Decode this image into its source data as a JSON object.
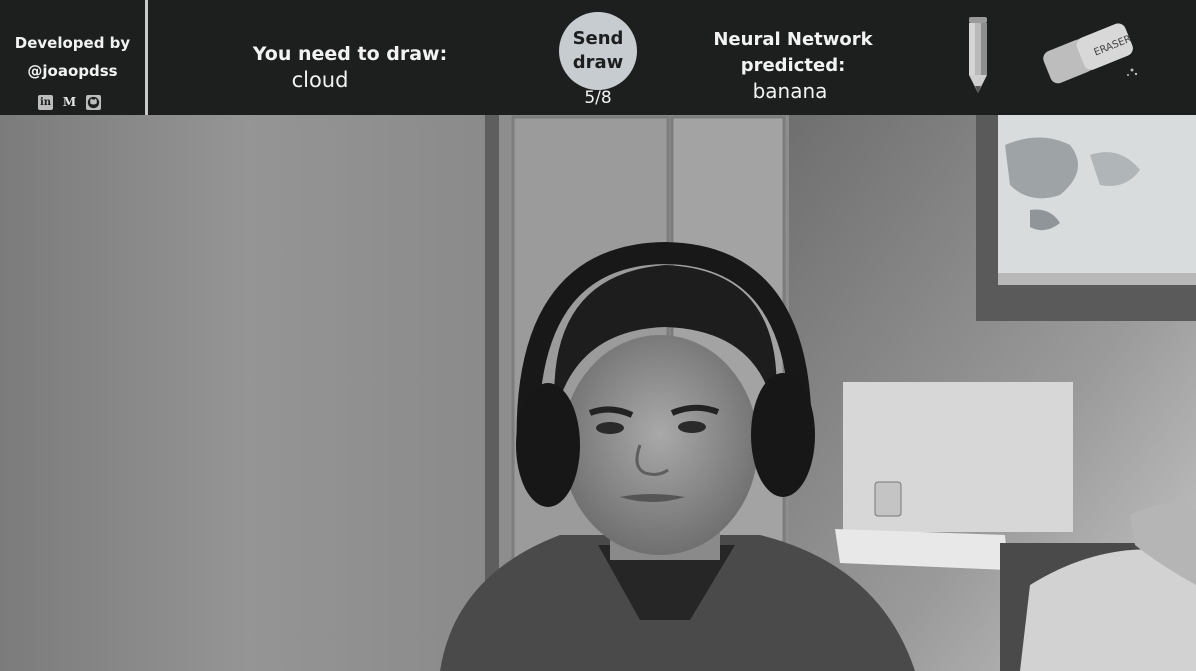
{
  "credits": {
    "line1": "Developed by",
    "line2": "@joaopdss"
  },
  "social": [
    {
      "icon": "linkedin-icon",
      "glyph": "in"
    },
    {
      "icon": "medium-icon",
      "glyph": "M"
    },
    {
      "icon": "github-icon",
      "glyph": ""
    }
  ],
  "task": {
    "label": "You need to draw:",
    "word": "cloud"
  },
  "send_button": {
    "line1": "Send",
    "line2": "draw"
  },
  "counter": "5/8",
  "prediction": {
    "label_line1": "Neural Network",
    "label_line2": "predicted:",
    "value": "banana"
  },
  "tools": {
    "pencil_icon": "pencil-icon",
    "eraser_icon": "eraser-icon",
    "eraser_text": "ERASER"
  },
  "colors": {
    "toolbar_bg": "#1d1f1f",
    "button_bg": "#c7ccd0",
    "text": "#f2f2f2"
  }
}
